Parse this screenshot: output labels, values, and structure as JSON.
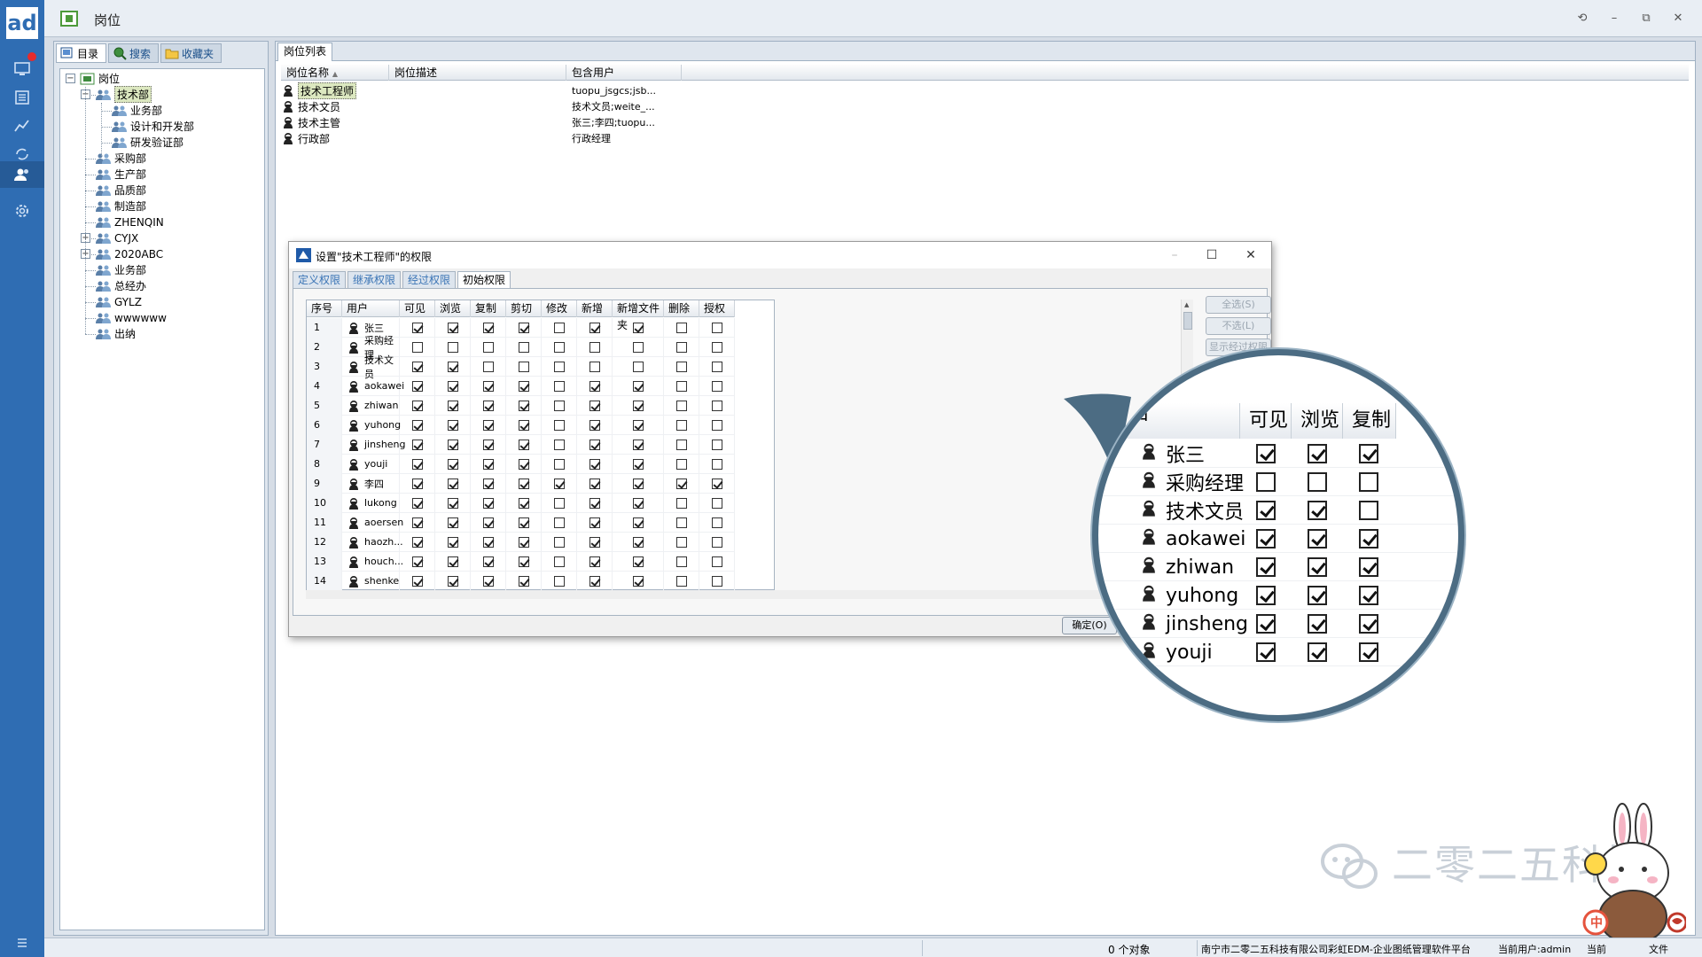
{
  "app": {
    "logo": "ad",
    "title": "岗位",
    "window_controls": [
      "⟲",
      "–",
      "⧉",
      "✕"
    ]
  },
  "sidebar_icons": [
    "monitor-icon",
    "document-list-icon",
    "chart-line-icon",
    "refresh-tag-icon",
    "users-icon",
    "settings-icon",
    "menu-icon"
  ],
  "side_panel": {
    "tabs": [
      {
        "label": "目录",
        "icon": "catalog-icon"
      },
      {
        "label": "搜索",
        "icon": "search-icon"
      },
      {
        "label": "收藏夹",
        "icon": "folder-icon"
      }
    ],
    "tree": {
      "root": "岗位",
      "nodes": [
        {
          "label": "技术部",
          "level": 1,
          "expanded": true,
          "selected": true
        },
        {
          "label": "业务部",
          "level": 2
        },
        {
          "label": "设计和开发部",
          "level": 2
        },
        {
          "label": "研发验证部",
          "level": 2
        },
        {
          "label": "采购部",
          "level": 1
        },
        {
          "label": "生产部",
          "level": 1
        },
        {
          "label": "品质部",
          "level": 1
        },
        {
          "label": "制造部",
          "level": 1
        },
        {
          "label": "ZHENQIN",
          "level": 1
        },
        {
          "label": "CYJX",
          "level": 1,
          "collapsed": true
        },
        {
          "label": "2020ABC",
          "level": 1,
          "collapsed": true
        },
        {
          "label": "业务部",
          "level": 1
        },
        {
          "label": "总经办",
          "level": 1
        },
        {
          "label": "GYLZ",
          "level": 1
        },
        {
          "label": "wwwwww",
          "level": 1
        },
        {
          "label": "出纳",
          "level": 1
        }
      ]
    }
  },
  "main": {
    "tab": "岗位列表",
    "columns": [
      "岗位名称",
      "岗位描述",
      "包含用户"
    ],
    "rows": [
      {
        "name": "技术工程师",
        "desc": "",
        "users": "tuopu_jsgcs;jsb...",
        "selected": true
      },
      {
        "name": "技术文员",
        "desc": "",
        "users": "技术文员;weite_..."
      },
      {
        "name": "技术主管",
        "desc": "",
        "users": "张三;李四;tuopu..."
      },
      {
        "name": "行政部",
        "desc": "",
        "users": "行政经理"
      }
    ]
  },
  "dialog": {
    "title": "设置\"技术工程师\"的权限",
    "tabs": [
      "定义权限",
      "继承权限",
      "经过权限",
      "初始权限"
    ],
    "active_tab": 3,
    "columns": [
      "序号",
      "用户",
      "可见",
      "浏览",
      "复制",
      "剪切",
      "修改",
      "新增",
      "新增文件夹",
      "删除",
      "授权"
    ],
    "rows": [
      {
        "n": "1",
        "user": "张三",
        "p": [
          1,
          1,
          1,
          1,
          0,
          1,
          1,
          0,
          0
        ]
      },
      {
        "n": "2",
        "user": "采购经理",
        "p": [
          0,
          0,
          0,
          0,
          0,
          0,
          0,
          0,
          0
        ]
      },
      {
        "n": "3",
        "user": "技术文员",
        "p": [
          1,
          1,
          0,
          0,
          0,
          0,
          0,
          0,
          0
        ]
      },
      {
        "n": "4",
        "user": "aokawei",
        "p": [
          1,
          1,
          1,
          1,
          0,
          1,
          1,
          0,
          0
        ]
      },
      {
        "n": "5",
        "user": "zhiwan",
        "p": [
          1,
          1,
          1,
          1,
          0,
          1,
          1,
          0,
          0
        ]
      },
      {
        "n": "6",
        "user": "yuhong",
        "p": [
          1,
          1,
          1,
          1,
          0,
          1,
          1,
          0,
          0
        ]
      },
      {
        "n": "7",
        "user": "jinsheng",
        "p": [
          1,
          1,
          1,
          1,
          0,
          1,
          1,
          0,
          0
        ]
      },
      {
        "n": "8",
        "user": "youji",
        "p": [
          1,
          1,
          1,
          1,
          0,
          1,
          1,
          0,
          0
        ]
      },
      {
        "n": "9",
        "user": "李四",
        "p": [
          1,
          1,
          1,
          1,
          1,
          1,
          1,
          1,
          1
        ]
      },
      {
        "n": "10",
        "user": "lukong",
        "p": [
          1,
          1,
          1,
          1,
          0,
          1,
          1,
          0,
          0
        ]
      },
      {
        "n": "11",
        "user": "aoersen",
        "p": [
          1,
          1,
          1,
          1,
          0,
          1,
          1,
          0,
          0
        ]
      },
      {
        "n": "12",
        "user": "haozh...",
        "p": [
          1,
          1,
          1,
          1,
          0,
          1,
          1,
          0,
          0
        ]
      },
      {
        "n": "13",
        "user": "houch...",
        "p": [
          1,
          1,
          1,
          1,
          0,
          1,
          1,
          0,
          0
        ]
      },
      {
        "n": "14",
        "user": "shenke",
        "p": [
          1,
          1,
          1,
          1,
          0,
          1,
          1,
          0,
          0
        ]
      }
    ],
    "side_buttons": [
      "全选(S)",
      "不选(L)",
      "显示经过权限"
    ],
    "ok_button": "确定(O)",
    "window_controls": [
      "–",
      "☐",
      "✕"
    ]
  },
  "magnifier": {
    "columns": [
      "用户",
      "可见",
      "浏览",
      "复制"
    ],
    "rows": [
      {
        "user": "张三",
        "p": [
          1,
          1,
          1
        ]
      },
      {
        "user": "采购经理",
        "p": [
          0,
          0,
          0
        ]
      },
      {
        "user": "技术文员",
        "p": [
          1,
          1,
          0
        ]
      },
      {
        "user": "aokawei",
        "p": [
          1,
          1,
          1
        ]
      },
      {
        "user": "zhiwan",
        "p": [
          1,
          1,
          1
        ]
      },
      {
        "user": "yuhong",
        "p": [
          1,
          1,
          1
        ]
      },
      {
        "user": "jinsheng",
        "p": [
          1,
          1,
          1
        ]
      },
      {
        "user": "youji",
        "p": [
          1,
          1,
          1
        ]
      }
    ]
  },
  "status": {
    "count": "0 个对象",
    "company": "南宁市二零二五科技有限公司彩虹EDM-企业图纸管理软件平台",
    "user": "当前用户:admin",
    "extra1": "当前",
    "extra2": "文件"
  },
  "watermark": "二零二五科技",
  "mascot_badge": "中",
  "colors": {
    "accent": "#2f6db3",
    "selection": "#dce8c0",
    "magnifier_border": "#4c6c83"
  }
}
